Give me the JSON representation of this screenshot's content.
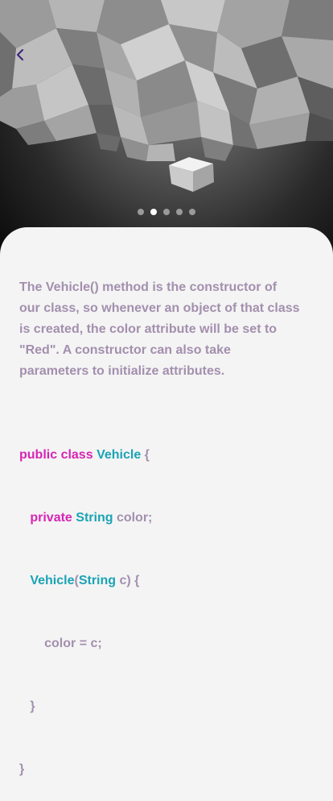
{
  "header": {
    "back_icon": "chevron-left-icon",
    "accent_color": "#3a1f7a"
  },
  "carousel": {
    "page_count": 5,
    "active_index": 1
  },
  "content": {
    "description": "The Vehicle() method is the constructor of our class, so whenever an object of that class is created, the color attribute will be set to \"Red\". A constructor can also take parameters to initialize attributes.",
    "code": {
      "line1": {
        "kw1": "public",
        "kw2": "class",
        "type": "Vehicle",
        "rest": "{"
      },
      "line2": {
        "indent": "   ",
        "kw": "private",
        "type": "String",
        "rest": "color;"
      },
      "line3": {
        "indent": "   ",
        "type": "Vehicle",
        "paren": "(",
        "type2": "String",
        "rest": "c) {"
      },
      "line4": {
        "indent": "       ",
        "text": "color = c;"
      },
      "line5": {
        "indent": "   ",
        "text": "}"
      },
      "line6": {
        "indent": "",
        "text": "}"
      }
    }
  },
  "colors": {
    "keyword": "#d625b4",
    "type": "#1aa3b5",
    "text": "#a38fae",
    "card_bg": "#f4f4f4"
  }
}
